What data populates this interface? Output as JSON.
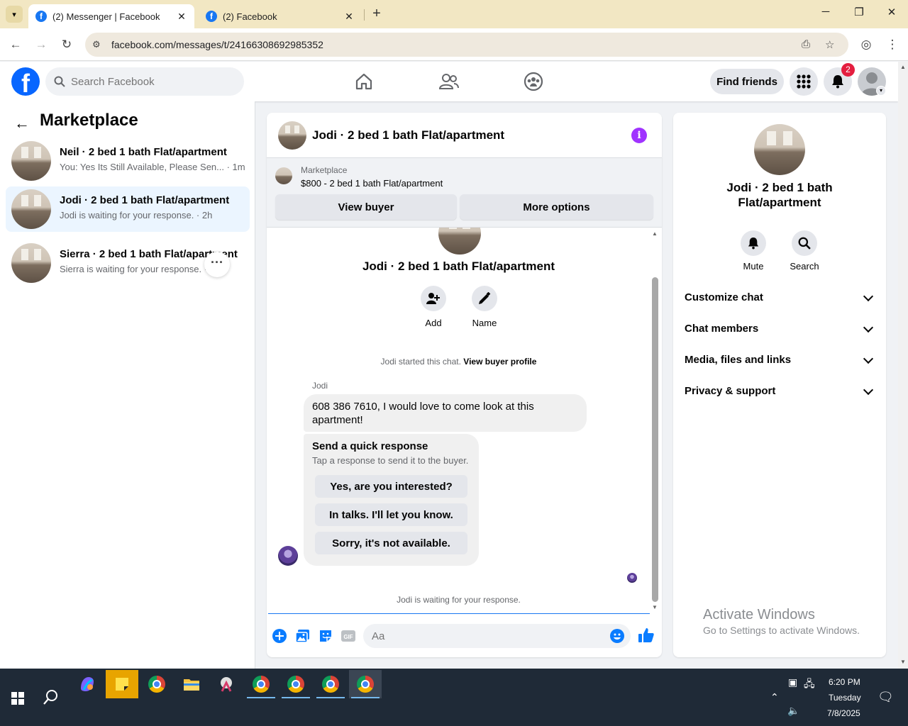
{
  "browser": {
    "tabs": [
      {
        "label": "(2) Messenger | Facebook",
        "active": true
      },
      {
        "label": "(2) Facebook",
        "active": false
      }
    ],
    "url": "facebook.com/messages/t/24166308692985352"
  },
  "header": {
    "search_placeholder": "Search Facebook",
    "find_friends_label": "Find friends",
    "notification_count": "2"
  },
  "sidebar": {
    "title": "Marketplace",
    "conversations": [
      {
        "title": "Neil · 2 bed 1 bath Flat/apartment",
        "preview": "You: Yes Its Still Available, Please Sen... · 1m",
        "active": false
      },
      {
        "title": "Jodi · 2 bed 1 bath Flat/apartment",
        "preview": "Jodi is waiting for your response. · 2h",
        "active": true
      },
      {
        "title": "Sierra · 2 bed 1 bath Flat/apartment",
        "preview": "Sierra is waiting for your response. · 4",
        "active": false
      }
    ]
  },
  "chat": {
    "title": "Jodi · 2 bed 1 bath Flat/apartment",
    "marketplace_label": "Marketplace",
    "listing": "$800 - 2 bed 1 bath Flat/apartment",
    "view_buyer_label": "View buyer",
    "more_options_label": "More options",
    "profile_name": "Jodi · 2 bed 1 bath Flat/apartment",
    "actions": [
      {
        "label": "Add",
        "icon": "add-person-icon"
      },
      {
        "label": "Name",
        "icon": "pencil-icon"
      }
    ],
    "system_text": "Jodi started this chat.",
    "system_link": "View buyer profile",
    "sender": "Jodi",
    "message": "608 386 7610,  I would love to come look at this apartment!",
    "quick_response": {
      "title": "Send a quick response",
      "subtitle": "Tap a response to send it to the buyer.",
      "options": [
        "Yes, are you interested?",
        "In talks. I'll let you know.",
        "Sorry, it's not available."
      ]
    },
    "waiting_text": "Jodi is waiting for your response.",
    "composer_placeholder": "Aa"
  },
  "right_panel": {
    "name": "Jodi · 2 bed 1 bath Flat/apartment",
    "actions": [
      {
        "label": "Mute",
        "icon": "bell-icon"
      },
      {
        "label": "Search",
        "icon": "search-icon"
      }
    ],
    "sections": [
      "Customize chat",
      "Chat members",
      "Media, files and links",
      "Privacy & support"
    ]
  },
  "watermark": {
    "line1": "Activate Windows",
    "line2": "Go to Settings to activate Windows."
  },
  "taskbar": {
    "time": "6:20 PM",
    "day": "Tuesday",
    "date": "7/8/2025"
  },
  "colors": {
    "facebook_blue": "#0866ff",
    "messenger_blue": "#0a7cff",
    "info_purple": "#a033ff",
    "badge_red": "#e41e3f"
  }
}
